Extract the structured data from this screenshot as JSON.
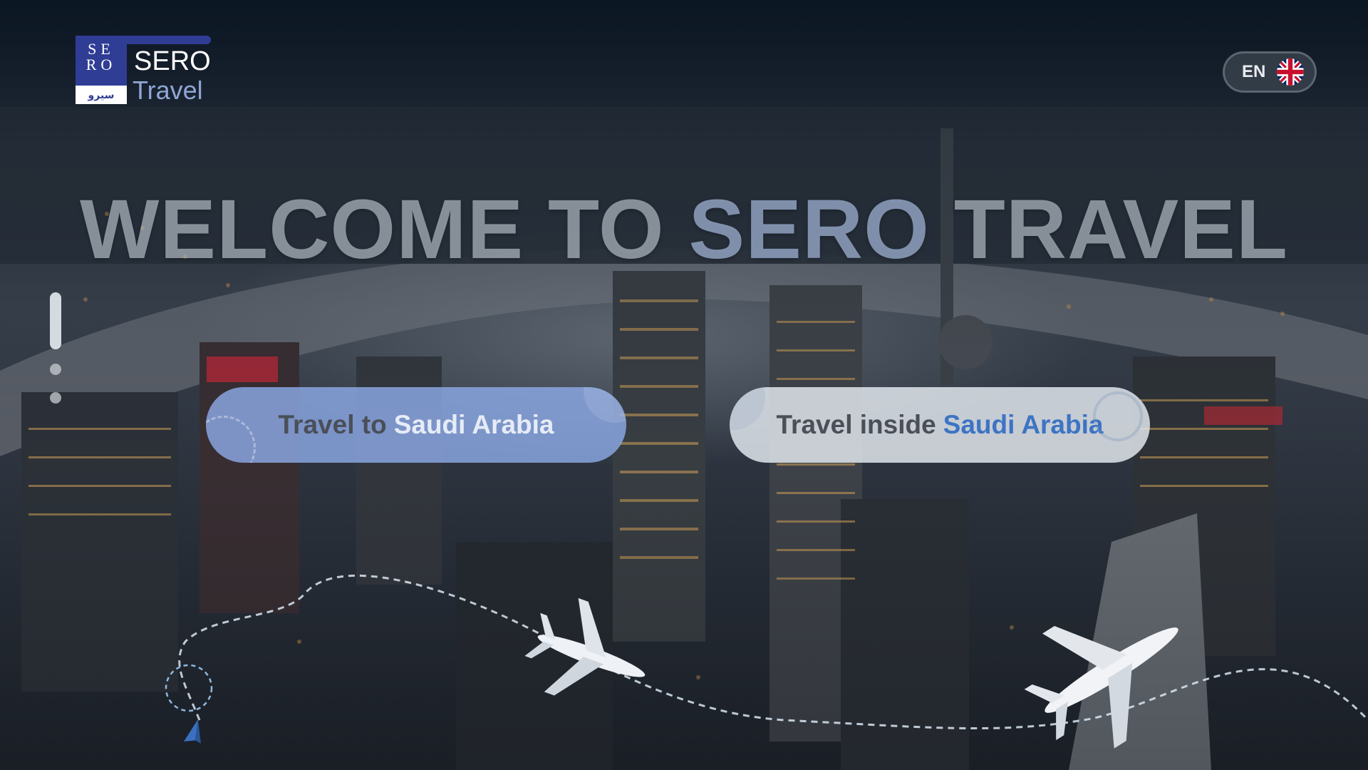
{
  "brand": {
    "mark_text": "SE RO",
    "mark_arabic": "سيرو",
    "name": "SERO",
    "subtitle": "Travel"
  },
  "language": {
    "code": "EN",
    "flag_icon": "uk-flag-icon"
  },
  "hero": {
    "title_part1": "WELCOME TO ",
    "title_accent": "SERO",
    "title_part2": " TRAVEL"
  },
  "slides": {
    "count": 3,
    "active": 1
  },
  "choices": [
    {
      "plain": "Travel to",
      "highlight": "Saudi Arabia"
    },
    {
      "plain": "Travel inside",
      "highlight": "Saudi Arabia"
    }
  ],
  "colors": {
    "brand_blue": "#2f3d95",
    "accent_blue": "#3d74c4",
    "left_button": "#8caae6",
    "right_button": "#e1e6ec"
  },
  "icons": [
    "airplane-icon",
    "paper-plane-icon",
    "uk-flag-icon"
  ]
}
